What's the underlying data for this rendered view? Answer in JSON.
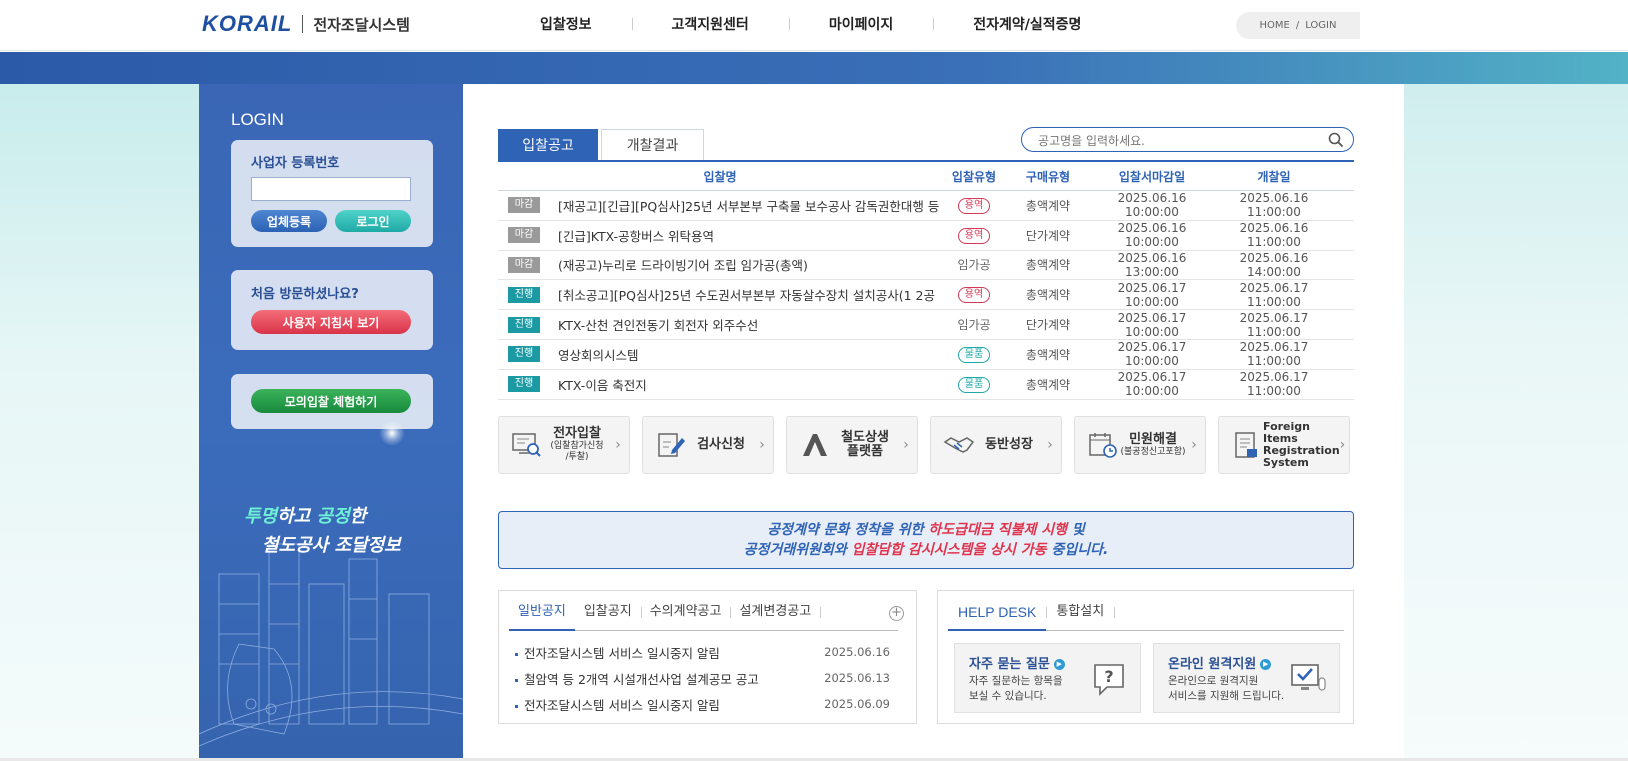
{
  "header": {
    "logo_text": "KORAIL",
    "system_name": "전자조달시스템",
    "nav": [
      "입찰정보",
      "고객지원센터",
      "마이페이지",
      "전자계약/실적증명"
    ],
    "util": {
      "home": "HOME",
      "sep": "/",
      "login": "LOGIN"
    }
  },
  "sidebar": {
    "title": "LOGIN",
    "login": {
      "label": "사업자 등록번호",
      "input_value": "",
      "register_button": "업체등록",
      "login_button": "로그인"
    },
    "first_visit": {
      "label": "처음 방문하셨나요?",
      "guide_button": "사용자 지침서 보기"
    },
    "mock_button": "모의입찰 체험하기",
    "slogan": {
      "l1_a": "투명",
      "l1_b": "하고 ",
      "l1_c": "공정",
      "l1_d": "한",
      "l2": "철도공사 조달정보"
    }
  },
  "tabs": {
    "bid": "입찰공고",
    "open": "개찰결과"
  },
  "search": {
    "placeholder": "공고명을 입력하세요."
  },
  "table": {
    "headers": {
      "name": "입찰명",
      "type": "입찰유형",
      "buy": "구매유형",
      "close": "입찰서마감일",
      "open": "개찰일"
    },
    "rows": [
      {
        "status": "마감",
        "status_kind": "closed",
        "name": "[재공고][긴급][PQ심사]25년 서부본부 구축물 보수공사 감독권한대행 등",
        "type": "용역",
        "type_kind": "red",
        "buy": "총액계약",
        "close": "2025.06.16 10:00:00",
        "open": "2025.06.16 11:00:00"
      },
      {
        "status": "마감",
        "status_kind": "closed",
        "name": "[긴급]KTX-공항버스 위탁용역",
        "type": "용역",
        "type_kind": "red",
        "buy": "단가계약",
        "close": "2025.06.16 10:00:00",
        "open": "2025.06.16 11:00:00"
      },
      {
        "status": "마감",
        "status_kind": "closed",
        "name": "(재공고)누리로 드라이빙기어 조립 임가공(총액)",
        "type": "임가공",
        "type_kind": "plain",
        "buy": "총액계약",
        "close": "2025.06.16 13:00:00",
        "open": "2025.06.16 14:00:00"
      },
      {
        "status": "진행",
        "status_kind": "prog",
        "name": "[취소공고][PQ심사]25년 수도권서부본부 자동살수장치 설치공사(1 2공",
        "type": "용역",
        "type_kind": "red",
        "buy": "총액계약",
        "close": "2025.06.17 10:00:00",
        "open": "2025.06.17 11:00:00"
      },
      {
        "status": "진행",
        "status_kind": "prog",
        "name": "KTX-산천 견인전동기 회전자 외주수선",
        "type": "임가공",
        "type_kind": "plain",
        "buy": "단가계약",
        "close": "2025.06.17 10:00:00",
        "open": "2025.06.17 11:00:00"
      },
      {
        "status": "진행",
        "status_kind": "prog",
        "name": "영상회의시스템",
        "type": "물품",
        "type_kind": "teal",
        "buy": "총액계약",
        "close": "2025.06.17 10:00:00",
        "open": "2025.06.17 11:00:00"
      },
      {
        "status": "진행",
        "status_kind": "prog",
        "name": "KTX-이음 축전지",
        "type": "물품",
        "type_kind": "teal",
        "buy": "총액계약",
        "close": "2025.06.17 10:00:00",
        "open": "2025.06.17 11:00:00"
      }
    ]
  },
  "quick_links": [
    {
      "icon": "monitor-search-icon",
      "label": "전자입찰",
      "sub": "(입찰참가신청\n/투찰)"
    },
    {
      "icon": "pencil-doc-icon",
      "label": "검사신청",
      "sub": ""
    },
    {
      "icon": "platform-logo-icon",
      "label": "철도상생\n플랫폼",
      "sub": ""
    },
    {
      "icon": "handshake-icon",
      "label": "동반성장",
      "sub": ""
    },
    {
      "icon": "calendar-clock-icon",
      "label": "민원해결",
      "sub": "(불공정신고포함)"
    },
    {
      "icon": "document-list-icon",
      "label": "Foreign Items\nRegistration\nSystem",
      "sub": ""
    }
  ],
  "notice": {
    "l1_a": "공정계약 문화 정착을 위한 ",
    "l1_b": "하도급대금 직불제 시행",
    "l1_c": " 및",
    "l2_a": "공정거래위원회와 ",
    "l2_b": "입찰담합 감시시스템을 상시 가동",
    "l2_c": " 중입니다."
  },
  "board": {
    "tabs": [
      "일반공지",
      "입찰공지",
      "수의계약공고",
      "설계변경공고"
    ],
    "more": "+",
    "items": [
      {
        "title": "전자조달시스템 서비스 일시중지 알림",
        "date": "2025.06.16"
      },
      {
        "title": "철암역 등 2개역 시설개선사업 설계공모 공고",
        "date": "2025.06.13"
      },
      {
        "title": "전자조달시스템 서비스 일시중지 알림",
        "date": "2025.06.09"
      }
    ]
  },
  "helpdesk": {
    "tabs": [
      "HELP DESK",
      "통합설치"
    ],
    "faq": {
      "title": "자주 묻는 질문",
      "desc": "자주 질문하는 항목을\n보실 수 있습니다."
    },
    "remote": {
      "title": "온라인 원격지원",
      "desc": "온라인으로 원격지원\n서비스를 지원해 드립니다."
    }
  },
  "colors": {
    "primary": "#2e63b6",
    "teal": "#1b9aa3",
    "red": "#e0334d"
  }
}
